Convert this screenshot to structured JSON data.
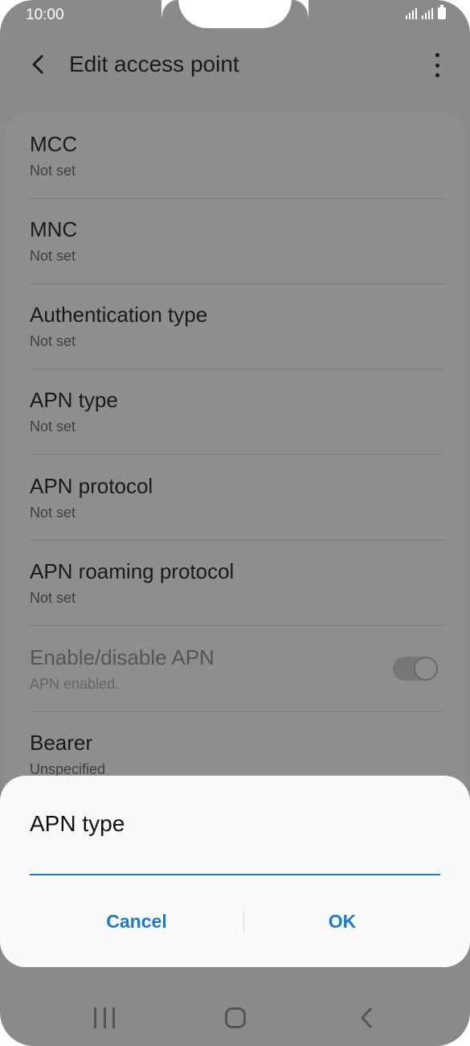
{
  "status_bar": {
    "time": "10:00",
    "icons": [
      "signal-icon",
      "signal-icon",
      "battery-icon"
    ]
  },
  "app_bar": {
    "title": "Edit access point",
    "back_icon": "back-arrow-icon",
    "menu_icon": "more-vertical-icon"
  },
  "settings": [
    {
      "label": "MCC",
      "value": "Not set"
    },
    {
      "label": "MNC",
      "value": "Not set"
    },
    {
      "label": "Authentication type",
      "value": "Not set"
    },
    {
      "label": "APN type",
      "value": "Not set"
    },
    {
      "label": "APN protocol",
      "value": "Not set"
    },
    {
      "label": "APN roaming protocol",
      "value": "Not set"
    },
    {
      "label": "Enable/disable APN",
      "value": "APN enabled.",
      "toggle": true,
      "disabled": true
    },
    {
      "label": "Bearer",
      "value": "Unspecified"
    }
  ],
  "dialog": {
    "title": "APN type",
    "input_value": "",
    "cancel_label": "Cancel",
    "ok_label": "OK",
    "accent_color": "#1a7bc9"
  },
  "nav_bar": {
    "icons": [
      "recents-icon",
      "home-icon",
      "back-icon"
    ]
  }
}
